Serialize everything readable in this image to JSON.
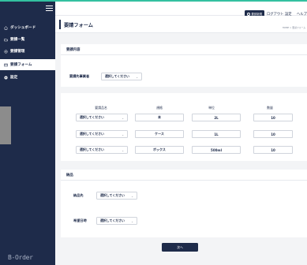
{
  "sidebar": {
    "items": [
      {
        "label": "ダッシュボード",
        "icon": "home-icon",
        "active": false
      },
      {
        "label": "要請一覧",
        "icon": "list-icon",
        "active": false
      },
      {
        "label": "要請管理",
        "icon": "manage-icon",
        "active": false
      },
      {
        "label": "要請フォーム",
        "icon": "form-icon",
        "active": true
      },
      {
        "label": "設定",
        "icon": "gear-icon",
        "active": false
      }
    ],
    "brand": "B-Order"
  },
  "topbar": {
    "button_label": "要請新規",
    "logout": "ログアウト",
    "settings": "設定",
    "help": "ヘルプ"
  },
  "header": {
    "title": "要請フォーム",
    "breadcrumb": "HOME > 要請フォーム"
  },
  "request_section": {
    "title": "要請内容",
    "supplier_label": "要請先事業者",
    "supplier_select": "選択してください"
  },
  "items_table": {
    "columns": [
      "要請品名",
      "規格",
      "単位",
      "数量"
    ],
    "rows": [
      {
        "item": "選択してください",
        "spec": "本",
        "unit": "2L",
        "qty": "10"
      },
      {
        "item": "選択してください",
        "spec": "ケース",
        "unit": "1L",
        "qty": "10"
      },
      {
        "item": "選択してください",
        "spec": "ボックス",
        "unit": "500ml",
        "qty": "10"
      }
    ]
  },
  "delivery_section": {
    "title": "納品",
    "destination_label": "納品先",
    "destination_select": "選択してください",
    "date_label": "希望日時",
    "date_select": "選択してください"
  },
  "next_button": "次へ",
  "colors": {
    "navy": "#1e2b4a",
    "teal_accent": "#33c0a0",
    "background": "#f3f4f6"
  }
}
